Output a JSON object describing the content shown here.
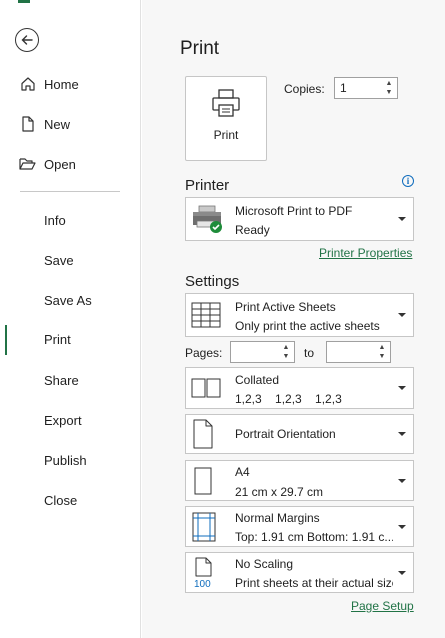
{
  "sidebar": {
    "back_icon": "back-arrow-icon",
    "items": [
      {
        "label": "Home",
        "icon": "home-icon"
      },
      {
        "label": "New",
        "icon": "new-document-icon"
      },
      {
        "label": "Open",
        "icon": "open-folder-icon"
      },
      {
        "label": "Info"
      },
      {
        "label": "Save"
      },
      {
        "label": "Save As"
      },
      {
        "label": "Print",
        "active": true
      },
      {
        "label": "Share"
      },
      {
        "label": "Export"
      },
      {
        "label": "Publish"
      },
      {
        "label": "Close"
      }
    ]
  },
  "main": {
    "title": "Print",
    "print_button_label": "Print",
    "copies_label": "Copies:",
    "copies_value": "1",
    "printer_section": "Printer",
    "printer": {
      "name": "Microsoft Print to PDF",
      "status": "Ready"
    },
    "printer_properties": "Printer Properties",
    "settings_section": "Settings",
    "print_what": {
      "title": "Print Active Sheets",
      "subtitle": "Only print the active sheets"
    },
    "pages_label": "Pages:",
    "pages_from": "",
    "to_label": "to",
    "pages_to": "",
    "collation": {
      "title": "Collated",
      "subtitle": "1,2,3    1,2,3    1,2,3"
    },
    "orientation": {
      "title": "Portrait Orientation"
    },
    "paper": {
      "title": "A4",
      "subtitle": "21 cm x 29.7 cm"
    },
    "margins": {
      "title": "Normal Margins",
      "subtitle": "Top: 1.91 cm Bottom: 1.91 c..."
    },
    "scaling": {
      "title": "No Scaling",
      "subtitle": "Print sheets at their actual size",
      "icon_text": "100"
    },
    "page_setup": "Page Setup"
  },
  "colors": {
    "accent": "#217346",
    "info": "#0f6cbd",
    "panel": "#f7f7f7"
  }
}
